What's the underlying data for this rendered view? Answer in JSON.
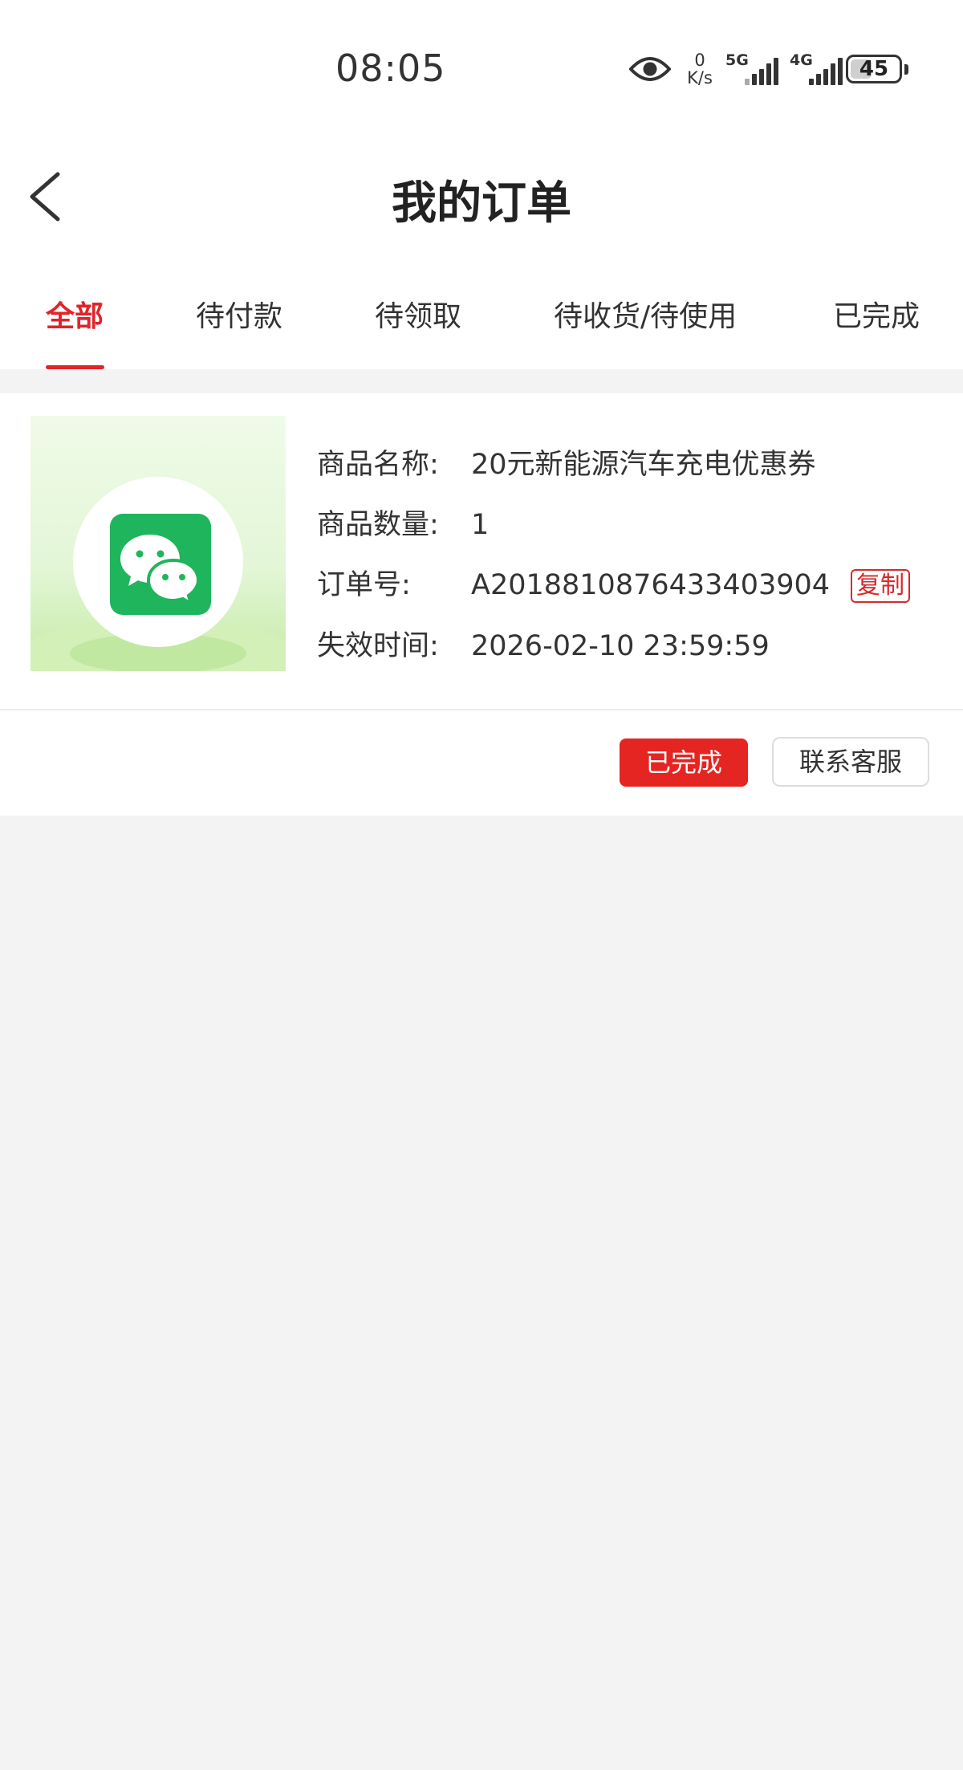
{
  "status_bar": {
    "time": "08:05",
    "net_speed_value": "0",
    "net_speed_unit": "K/s",
    "sim1_label": "5G",
    "sim2_label": "4G",
    "battery": "45"
  },
  "header": {
    "back_icon": "chevron-left-icon",
    "title": "我的订单"
  },
  "tabs": [
    {
      "label": "全部",
      "active": true
    },
    {
      "label": "待付款",
      "active": false
    },
    {
      "label": "待领取",
      "active": false
    },
    {
      "label": "待收货/待使用",
      "active": false
    },
    {
      "label": "已完成",
      "active": false
    }
  ],
  "order": {
    "thumbnail_icon": "wechat-icon",
    "product_name_label": "商品名称:",
    "product_name": "20元新能源汽车充电优惠券",
    "quantity_label": "商品数量:",
    "quantity": "1",
    "order_no_label": "订单号:",
    "order_no": "A2018810876433403904",
    "copy_label": "复制",
    "expire_label": "失效时间:",
    "expire_time": "2026-02-10 23:59:59",
    "status_button": "已完成",
    "contact_button": "联系客服"
  },
  "colors": {
    "accent": "#e1242a",
    "wechat_green": "#1fb55c",
    "background": "#f3f3f3"
  }
}
